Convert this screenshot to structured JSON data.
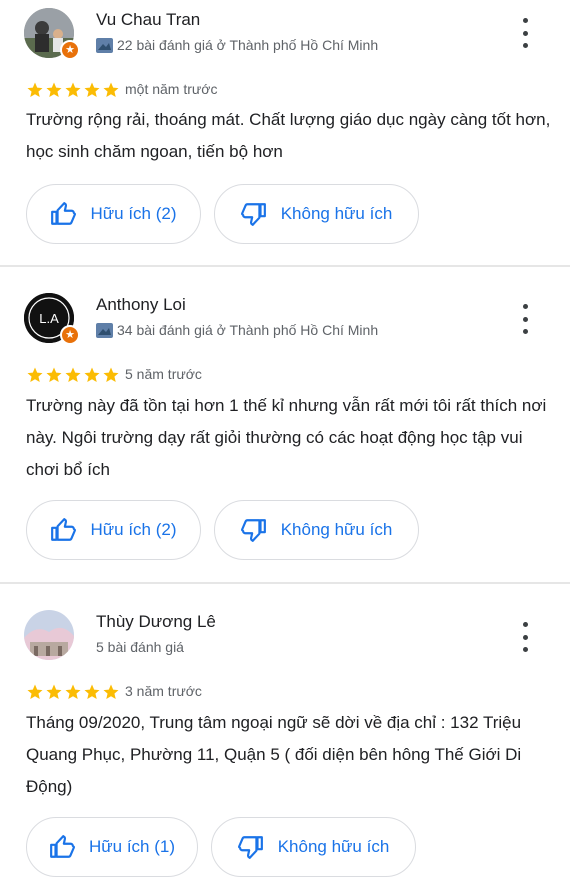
{
  "reviews": [
    {
      "author": "Vu Chau Tran",
      "local_guide": true,
      "meta": "22 bài đánh giá ở Thành phố Hồ Chí Minh",
      "rating": 5,
      "time": "một năm trước",
      "text": "Trường rộng rải, thoáng mát. Chất lượng giáo dục ngày càng tốt hơn, học sinh chăm ngoan, tiến bộ hơn",
      "helpful_label": "Hữu ích (2)",
      "not_helpful_label": "Không hữu ích"
    },
    {
      "author": "Anthony Loi",
      "avatar_initials": "L.A",
      "local_guide": true,
      "meta": "34 bài đánh giá ở Thành phố Hồ Chí Minh",
      "rating": 5,
      "time": "5 năm trước",
      "text": "Trường này đã tồn tại hơn 1 thế kỉ nhưng vẫn rất mới tôi rất thích nơi này. Ngôi trường dạy rất giỏi thường có các hoạt động học tập vui chơi bổ ích",
      "helpful_label": "Hữu ích (2)",
      "not_helpful_label": "Không hữu ích"
    },
    {
      "author": "Thùy Dương Lê",
      "local_guide": false,
      "meta": "5 bài đánh giá",
      "rating": 5,
      "time": "3 năm trước",
      "text": "Tháng 09/2020, Trung tâm ngoại ngữ sẽ dời về địa chỉ : 132 Triệu Quang Phục, Phường 11, Quận 5 ( đối diện bên hông Thế Giới Di Động)",
      "helpful_label": "Hữu ích (1)",
      "not_helpful_label": "Không hữu ích"
    }
  ],
  "colors": {
    "accent": "#1a73e8",
    "star": "#fbbc04",
    "local_guide_badge": "#e8710a"
  }
}
